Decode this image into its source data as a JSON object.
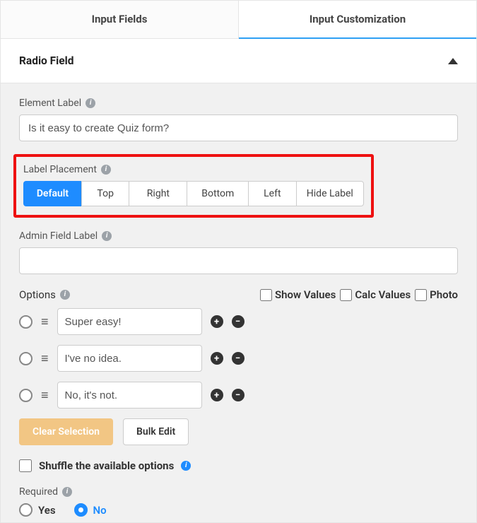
{
  "tabs": {
    "inputFields": "Input Fields",
    "inputCustomization": "Input Customization"
  },
  "panelTitle": "Radio Field",
  "elementLabel": {
    "label": "Element Label",
    "value": "Is it easy to create Quiz form?"
  },
  "labelPlacement": {
    "label": "Label Placement",
    "segments": [
      "Default",
      "Top",
      "Right",
      "Bottom",
      "Left",
      "Hide Label"
    ]
  },
  "adminFieldLabel": {
    "label": "Admin Field Label",
    "value": ""
  },
  "options": {
    "label": "Options",
    "checkboxes": {
      "showValues": "Show Values",
      "calcValues": "Calc Values",
      "photo": "Photo"
    },
    "items": [
      "Super easy!",
      "I've no idea.",
      "No, it's not."
    ]
  },
  "buttons": {
    "clearSelection": "Clear Selection",
    "bulkEdit": "Bulk Edit"
  },
  "shuffle": {
    "label": "Shuffle the available options"
  },
  "required": {
    "label": "Required",
    "yes": "Yes",
    "no": "No"
  }
}
